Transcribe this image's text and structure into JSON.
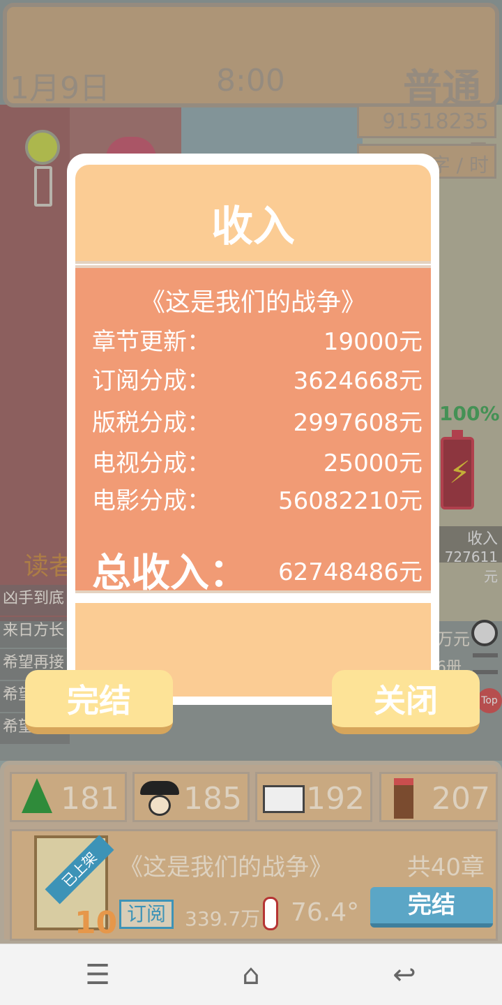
{
  "header": {
    "date": "1月9日",
    "time": "8:00",
    "mode": "普通"
  },
  "status": {
    "money": "91518235元",
    "rate": "字 / 时",
    "battery_pct": "100%"
  },
  "side": {
    "reader_label": "读者",
    "income_label": "收入",
    "income_value": "727611元",
    "right_text_1": "万元",
    "right_text_2": "6册",
    "top_badge": "Top",
    "books": [
      "凶手到底",
      "来日方长",
      "希望再接",
      "希望",
      "希望"
    ]
  },
  "modal": {
    "title": "收入",
    "book_title": "《这是我们的战争》",
    "rows": [
      {
        "label": "章节更新：",
        "value": "19000元"
      },
      {
        "label": "订阅分成：",
        "value": "3624668元"
      },
      {
        "label": "版税分成：",
        "value": "2997608元"
      },
      {
        "label": "电视分成：",
        "value": "25000元"
      },
      {
        "label": "电影分成：",
        "value": "56082210元"
      }
    ],
    "total_label": "总收入：",
    "total_value": "62748486元",
    "finish_button": "完结",
    "close_button": "关闭"
  },
  "stats": {
    "trees": "181",
    "fans": "185",
    "readers": "192",
    "writing": "207"
  },
  "book_card": {
    "ribbon": "已上架",
    "cover_num": "10",
    "title": "《这是我们的战争》",
    "chapters": "共40章",
    "sub_label": "订阅",
    "sub_value": "339.7万",
    "heat": "76.4°",
    "finish_button": "完结"
  },
  "nav": {
    "menu": "☰",
    "home": "⌂",
    "back": "↩"
  },
  "colors": {
    "modal_body": "#f19b75",
    "modal_band": "#fbcc94",
    "button": "#fde397",
    "book_button": "#5ba6c6"
  }
}
